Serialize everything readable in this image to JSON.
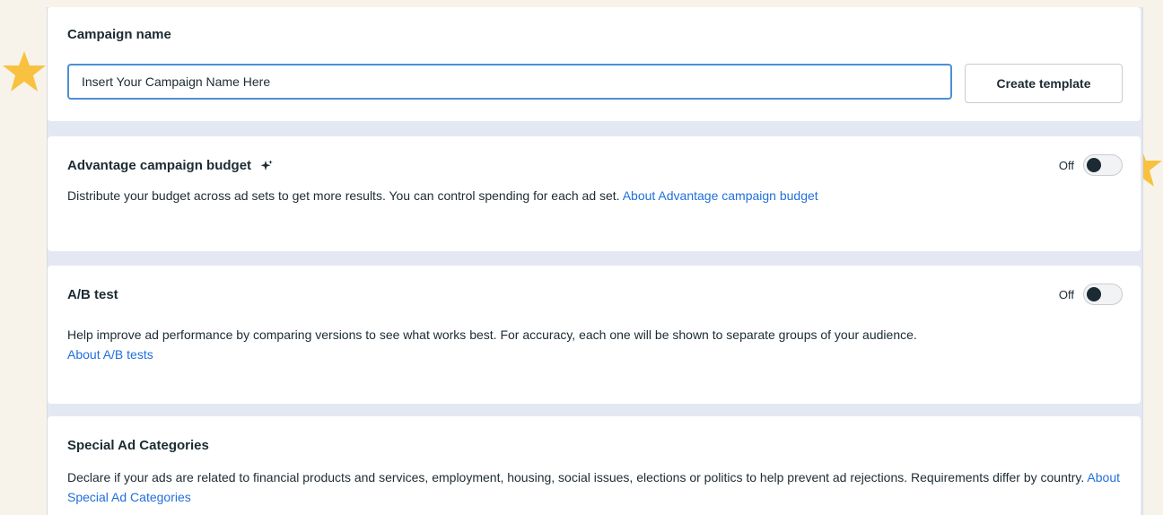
{
  "campaign_name": {
    "title": "Campaign name",
    "input_value": "Insert Your Campaign Name Here",
    "create_template_label": "Create template"
  },
  "advantage_budget": {
    "title": "Advantage campaign budget",
    "toggle_label": "Off",
    "toggle_on": false,
    "description": "Distribute your budget across ad sets to get more results. You can control spending for each ad set.",
    "link": "About Advantage campaign budget"
  },
  "ab_test": {
    "title": "A/B test",
    "toggle_label": "Off",
    "toggle_on": false,
    "description": "Help improve ad performance by comparing versions to see what works best. For accuracy, each one will be shown to separate groups of your audience.",
    "link": "About A/B tests"
  },
  "special_ad_categories": {
    "title": "Special Ad Categories",
    "description": "Declare if your ads are related to financial products and services, employment, housing, social issues, elections or politics to help prevent ad rejections. Requirements differ by country.",
    "link": "About Special Ad Categories"
  },
  "colors": {
    "accent_link": "#216fdb",
    "input_focus_border": "#4a90d9",
    "star": "#f8c240",
    "background": "#f8f3ea",
    "text": "#1c2b33"
  },
  "icons": {
    "sparkle": "sparkle-icon",
    "star": "star-icon"
  }
}
